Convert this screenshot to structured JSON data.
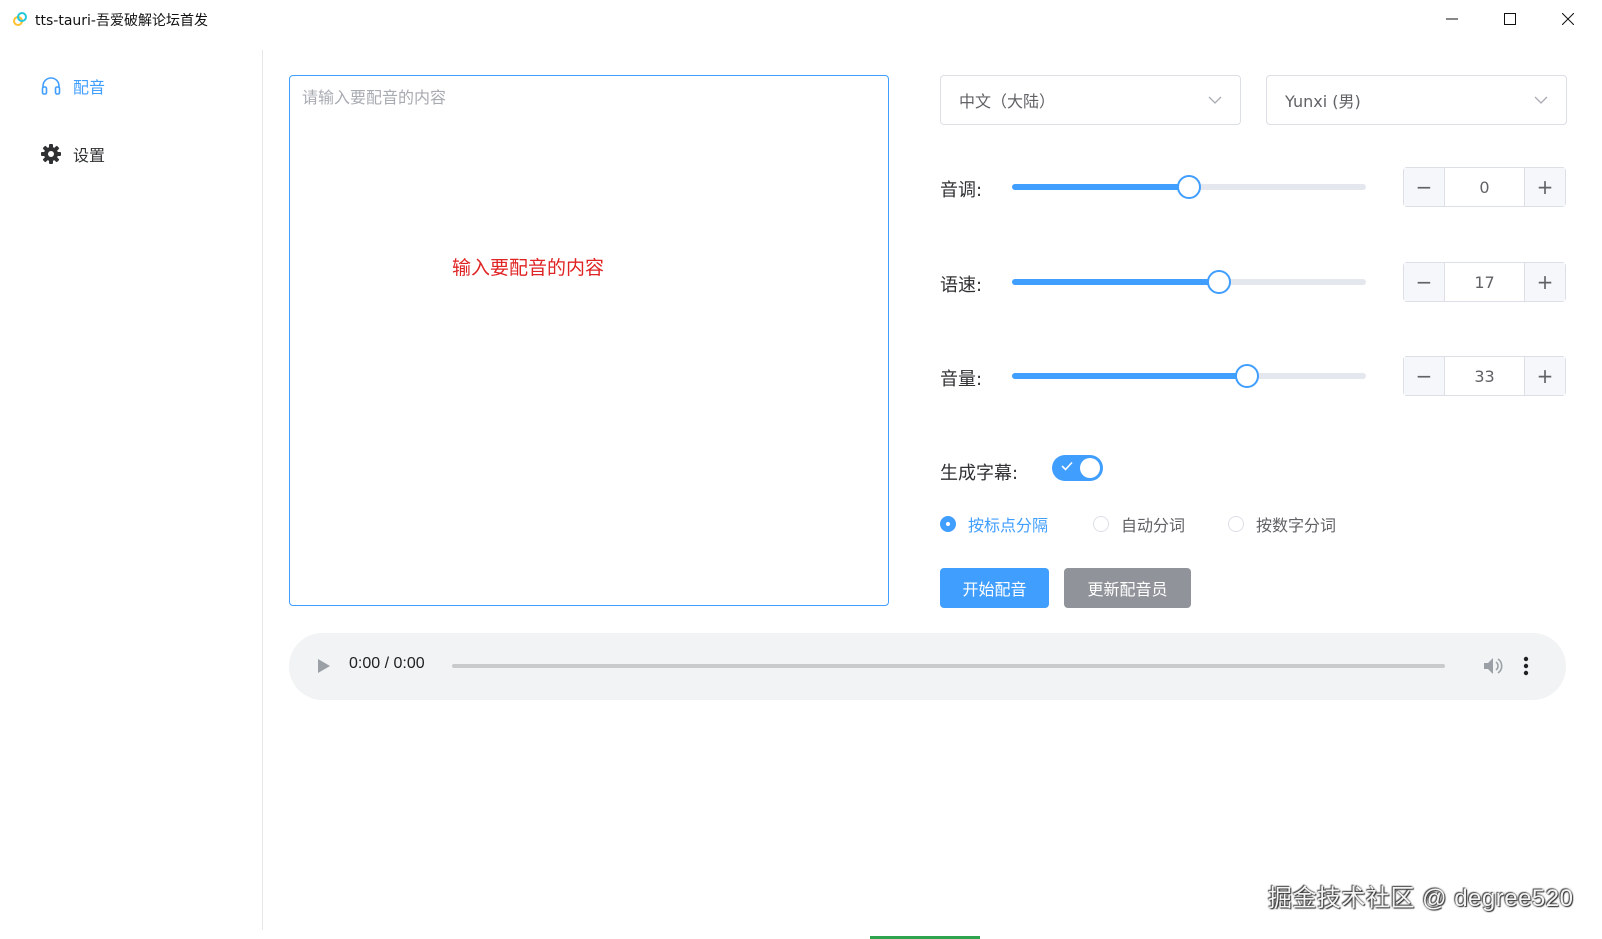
{
  "window": {
    "title": "tts-tauri-吾爱破解论坛首发"
  },
  "sidebar": {
    "items": [
      {
        "label": "配音",
        "icon": "headphones-icon",
        "active": true
      },
      {
        "label": "设置",
        "icon": "gear-icon",
        "active": false
      }
    ]
  },
  "editor": {
    "placeholder": "请输入要配音的内容",
    "value": "",
    "hint": "输入要配音的内容"
  },
  "language_select": {
    "value": "中文（大陆）"
  },
  "voice_select": {
    "value": "Yunxi (男)"
  },
  "controls": {
    "pitch": {
      "label": "音调:",
      "value": "0",
      "level_percent": 50
    },
    "rate": {
      "label": "语速:",
      "value": "17",
      "level_percent": 58.5
    },
    "volume": {
      "label": "音量:",
      "value": "33",
      "level_percent": 66.5
    }
  },
  "subtitle": {
    "label": "生成字幕:",
    "enabled": true
  },
  "split_options": [
    {
      "label": "按标点分隔",
      "checked": true
    },
    {
      "label": "自动分词",
      "checked": false
    },
    {
      "label": "按数字分词",
      "checked": false
    }
  ],
  "actions": {
    "start_label": "开始配音",
    "update_label": "更新配音员"
  },
  "player": {
    "time": "0:00 / 0:00"
  },
  "watermark": "掘金技术社区 @ degree520",
  "colors": {
    "accent": "#409eff",
    "secondary_button": "#909399",
    "hint_red": "#e02424"
  }
}
